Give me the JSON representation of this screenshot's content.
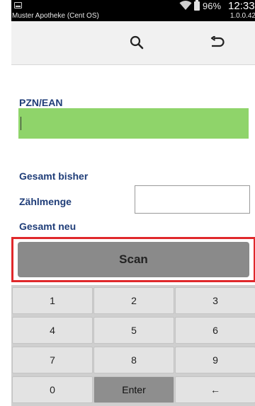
{
  "status_bar": {
    "app_name": "Muster Apotheke (Cent OS)",
    "version": "1.0.0.42",
    "battery": "96%",
    "time": "12:33",
    "icons": [
      "app-notification-icon",
      "wifi-icon",
      "battery-icon"
    ]
  },
  "toolbar": {
    "icons": [
      "search-icon",
      "back-arrow-icon"
    ]
  },
  "form": {
    "pzn_label": "PZN/EAN",
    "pzn_value": "",
    "gesamt_bisher_label": "Gesamt bisher",
    "gesamt_bisher_value": "",
    "zaehlmenge_label": "Zählmenge",
    "zaehlmenge_value": "",
    "gesamt_neu_label": "Gesamt neu",
    "gesamt_neu_value": ""
  },
  "scan_button": {
    "label": "Scan"
  },
  "keypad": {
    "keys": [
      "1",
      "2",
      "3",
      "4",
      "5",
      "6",
      "7",
      "8",
      "9",
      "0",
      "Enter",
      "←"
    ]
  },
  "colors": {
    "label_text": "#1f3d78",
    "input_active": "#8fd46a",
    "highlight_border": "#e0282b",
    "status_bar": "#000000"
  }
}
